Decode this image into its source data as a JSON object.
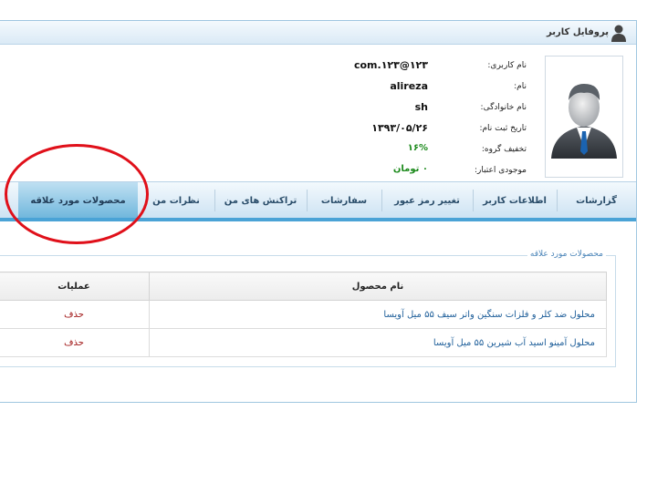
{
  "header": {
    "title": "پروفایل کاربر",
    "icon": "user-icon"
  },
  "profile": {
    "avatar_icon": "user-avatar-icon",
    "fields": [
      {
        "label": "نام کاربری:",
        "value": "com.۱۲۳@۱۲۳"
      },
      {
        "label": "نام:",
        "value": "alireza"
      },
      {
        "label": "نام خانوادگی:",
        "value": "sh"
      },
      {
        "label": "تاریخ ثبت نام:",
        "value": "۱۳۹۳/۰۵/۲۶"
      },
      {
        "label": "تخفیف گروه:",
        "value": "۱۶%"
      },
      {
        "label": "موجودی اعتبار:",
        "value": "۰ تومان"
      }
    ]
  },
  "tabs": [
    {
      "label": "گزارشات"
    },
    {
      "label": "اطلاعات کاربر"
    },
    {
      "label": "تغییر رمز عبور"
    },
    {
      "label": "سفارشات"
    },
    {
      "label": "تراکنش های من"
    },
    {
      "label": "نظرات من"
    },
    {
      "label": "محصولات مورد علاقه"
    }
  ],
  "active_tab": "محصولات مورد علاقه",
  "favorites": {
    "legend": "محصولات مورد علاقه",
    "columns": {
      "name": "نام محصول",
      "ops": "عملیات"
    },
    "rows": [
      {
        "name": "محلول ضد کلر و فلزات سنگین واتر سیف ۵۵ میل آویسا",
        "action": "حذف"
      },
      {
        "name": "محلول آمینو اسید آب شیرین ۵۵ میل آویسا",
        "action": "حذف"
      }
    ]
  },
  "colors": {
    "accent": "#4aa3d6",
    "highlight": "#e0101a",
    "delete": "#a01414",
    "link": "#1f5f9a"
  }
}
